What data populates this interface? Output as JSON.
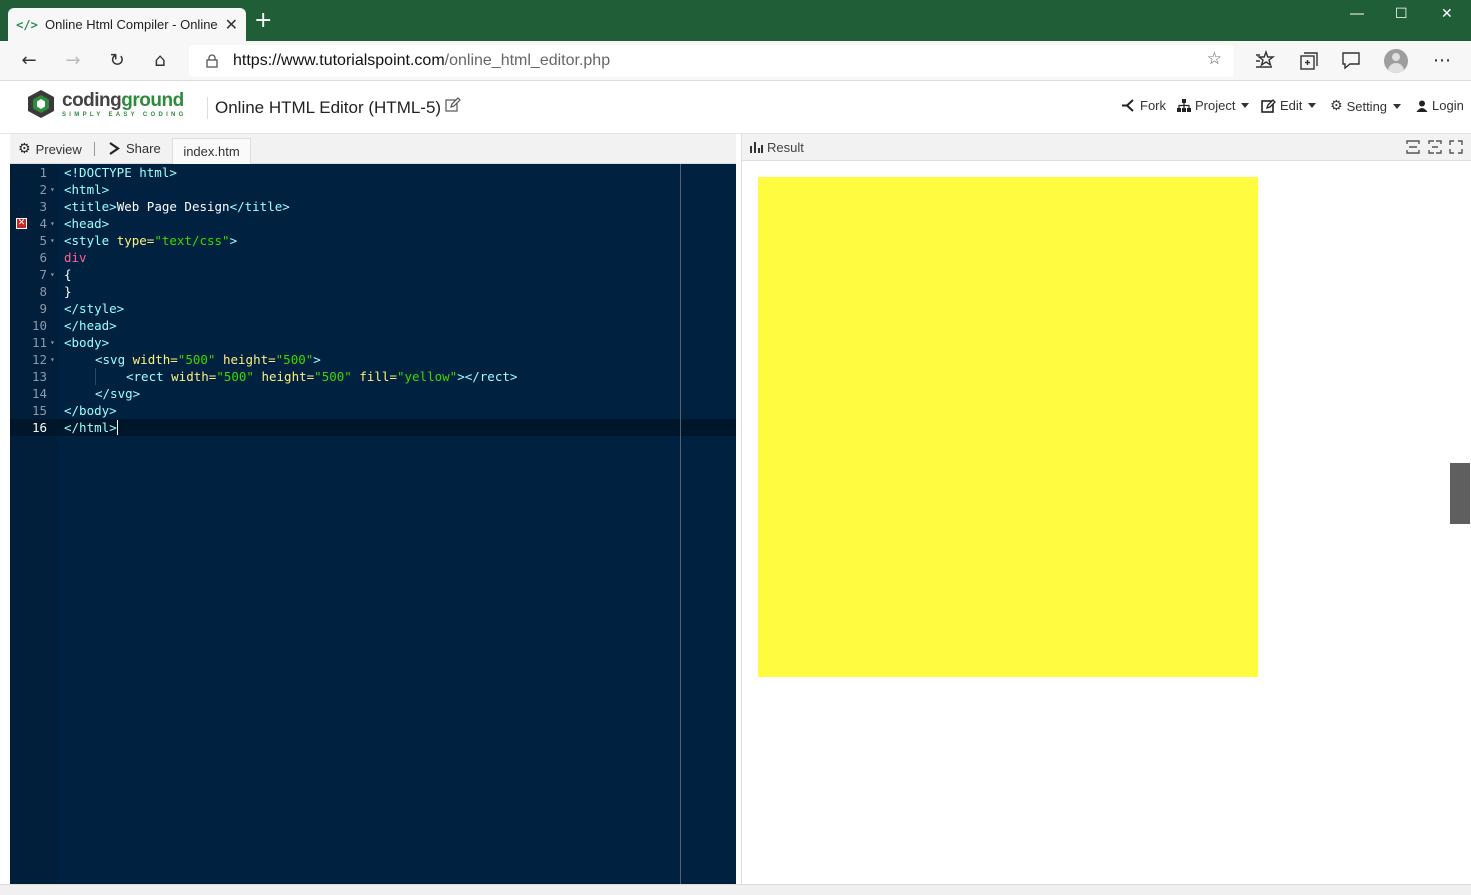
{
  "browser": {
    "tab_title": "Online Html Compiler - Online H",
    "tab_icon": "code-icon",
    "url_host": "https://www.tutorialspoint.com",
    "url_path": "/online_html_editor.php",
    "window_controls": [
      "minimize",
      "maximize",
      "close"
    ]
  },
  "app": {
    "logo_word_dark": "coding",
    "logo_word_green": "ground",
    "logo_tagline": "SIMPLY EASY CODING",
    "title": "Online HTML Editor (HTML-5)",
    "menu": {
      "fork": "Fork",
      "project": "Project",
      "edit": "Edit",
      "setting": "Setting",
      "login": "Login"
    }
  },
  "editor": {
    "preview_label": "Preview",
    "share_label": "Share",
    "file_tab": "index.htm",
    "error_line": 4,
    "active_line": 16,
    "line_numbers": [
      "1",
      "2",
      "3",
      "4",
      "5",
      "6",
      "7",
      "8",
      "9",
      "10",
      "11",
      "12",
      "13",
      "14",
      "15",
      "16"
    ],
    "code": {
      "l1": "<!DOCTYPE html>",
      "l2": "<html>",
      "l3_open": "<title>",
      "l3_text": "Web Page Design",
      "l3_close": "</title>",
      "l4": "<head>",
      "l5_tag": "<style ",
      "l5_attr": "type=",
      "l5_str": "\"text/css\"",
      "l5_end": ">",
      "l6": "div",
      "l7": "{",
      "l8": "}",
      "l9": "</style>",
      "l10": "</head>",
      "l11": "<body>",
      "l12_tag": "<svg ",
      "l12_a1": "width=",
      "l12_s1": "\"500\"",
      "l12_a2": " height=",
      "l12_s2": "\"500\"",
      "l12_end": ">",
      "l13_tag": "<rect ",
      "l13_a1": "width=",
      "l13_s1": "\"500\"",
      "l13_a2": " height=",
      "l13_s2": "\"500\"",
      "l13_a3": " fill=",
      "l13_s3": "\"yellow\"",
      "l13_end": "></rect>",
      "l14": "</svg>",
      "l15": "</body>",
      "l16": "</html>"
    }
  },
  "result": {
    "label": "Result",
    "rect_fill": "#fffc3f"
  },
  "colors": {
    "browser_frame": "#1f5e37",
    "editor_bg": "#002240",
    "brand_green": "#2e8b3c"
  }
}
